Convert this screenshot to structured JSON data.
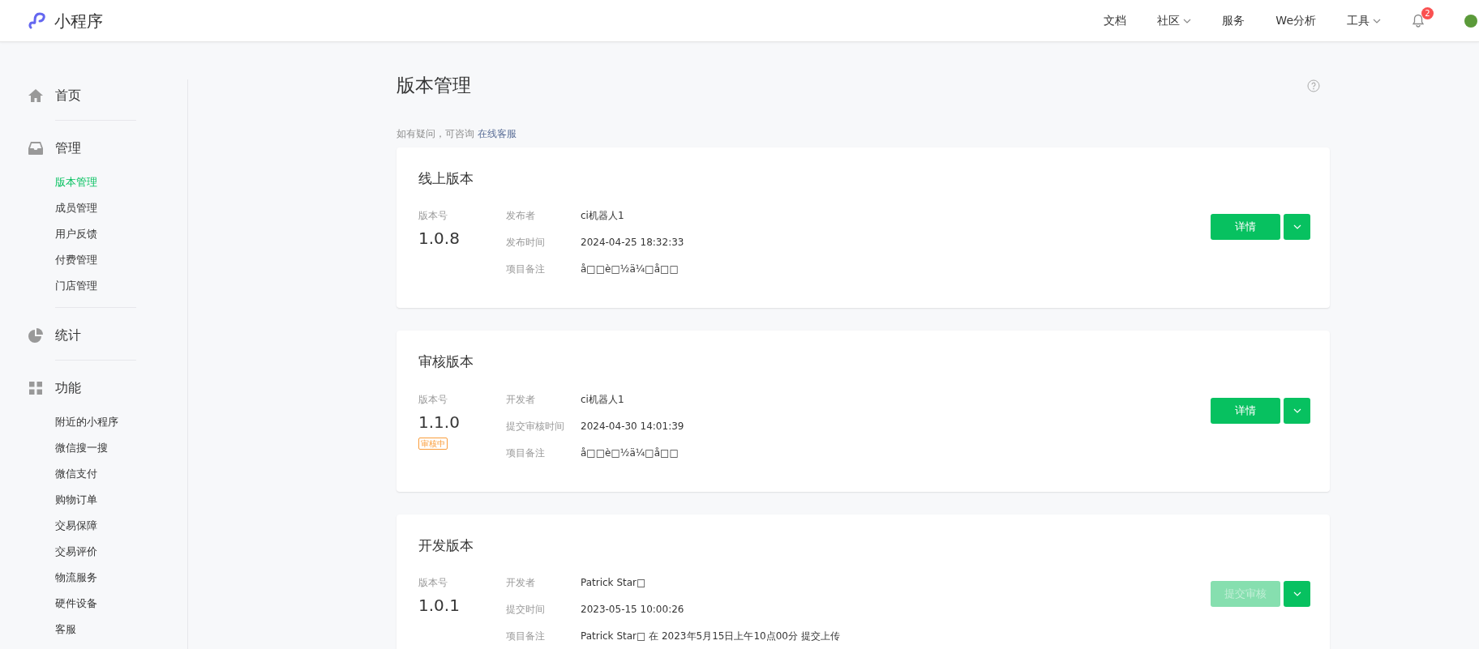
{
  "header": {
    "logo_text": "小程序",
    "nav": [
      {
        "label": "文档",
        "dropdown": false
      },
      {
        "label": "社区",
        "dropdown": true
      },
      {
        "label": "服务",
        "dropdown": false
      },
      {
        "label": "We分析",
        "dropdown": false
      },
      {
        "label": "工具",
        "dropdown": true
      }
    ],
    "notification_count": "2"
  },
  "sidebar": [
    {
      "label": "首页"
    },
    {
      "label": "管理",
      "items": [
        {
          "label": "版本管理",
          "selected": true
        },
        {
          "label": "成员管理",
          "selected": false
        },
        {
          "label": "用户反馈",
          "selected": false
        },
        {
          "label": "付费管理",
          "selected": false
        },
        {
          "label": "门店管理",
          "selected": false
        }
      ]
    },
    {
      "label": "统计"
    },
    {
      "label": "功能",
      "items": [
        {
          "label": "附近的小程序",
          "selected": false
        },
        {
          "label": "微信搜一搜",
          "selected": false
        },
        {
          "label": "微信支付",
          "selected": false
        },
        {
          "label": "购物订单",
          "selected": false
        },
        {
          "label": "交易保障",
          "selected": false
        },
        {
          "label": "交易评价",
          "selected": false
        },
        {
          "label": "物流服务",
          "selected": false
        },
        {
          "label": "硬件设备",
          "selected": false
        },
        {
          "label": "客服",
          "selected": false
        }
      ]
    }
  ],
  "page": {
    "title": "版本管理",
    "notice": "如有疑问，可咨询",
    "notice_link": "在线客服"
  },
  "cards": [
    {
      "title": "线上版本",
      "version_label": "版本号",
      "version": "1.0.8",
      "fields": [
        {
          "label": "发布者",
          "value": "ci机器人1"
        },
        {
          "label": "发布时间",
          "value": "2024-04-25 18:32:33"
        },
        {
          "label": "项目备注",
          "value": "å□□è□½ä¼□å□□"
        }
      ],
      "button": {
        "label": "详情",
        "disabled": false
      }
    },
    {
      "title": "审核版本",
      "version_label": "版本号",
      "version": "1.1.0",
      "tag": "审核中",
      "fields": [
        {
          "label": "开发者",
          "value": "ci机器人1"
        },
        {
          "label": "提交审核时间",
          "value": "2024-04-30 14:01:39"
        },
        {
          "label": "项目备注",
          "value": "å□□è□½ä¼□å□□"
        }
      ],
      "button": {
        "label": "详情",
        "disabled": false
      }
    },
    {
      "title": "开发版本",
      "version_label": "版本号",
      "version": "1.0.1",
      "fields": [
        {
          "label": "开发者",
          "value": "Patrick Star□"
        },
        {
          "label": "提交时间",
          "value": "2023-05-15 10:00:26"
        },
        {
          "label": "项目备注",
          "value": "Patrick Star□ 在 2023年5月15日上午10点00分 提交上传"
        }
      ],
      "button": {
        "label": "提交审核",
        "disabled": true
      }
    }
  ]
}
